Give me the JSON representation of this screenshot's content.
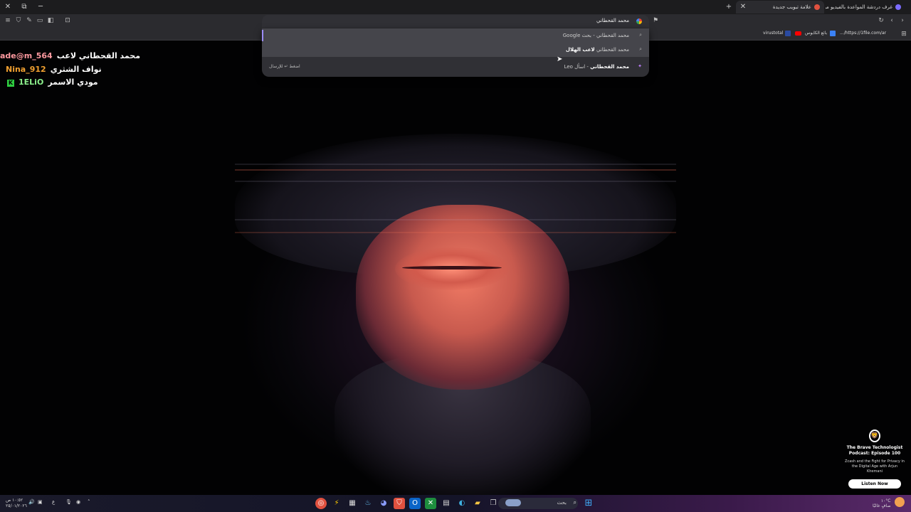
{
  "browser": {
    "tabs": [
      {
        "title": "علامة تبويب جديدة",
        "active": true
      },
      {
        "title": "غرف دردشة المواعدة بالفيديو من ..."
      }
    ],
    "window_buttons": {
      "close": "✕",
      "restore": "⧉",
      "minimize": "─"
    },
    "new_tab": "+",
    "tab_close": "✕"
  },
  "omnibox": {
    "value": "محمد القحطاني"
  },
  "suggestions": [
    {
      "bold": "محمد القحطاني",
      "rest": " - بحث Google"
    },
    {
      "bold": "لاعب الهلال",
      "rest": "محمد القحطاني "
    },
    {
      "bold": "محمد القحطاني",
      "rest": " - اسأل Leo"
    }
  ],
  "enter_hint": "اضغط ↵ للإرسال",
  "bookmarks": [
    {
      "label": "virustotal"
    },
    {
      "label": "بائع الكابوس"
    },
    {
      "label": "https://1file.com/ar/..."
    }
  ],
  "chat_overlay": [
    {
      "name": "ade@m_564",
      "message": "محمد القحطاني لاعب",
      "color": "#ff9aa0"
    },
    {
      "name": "Nina_912",
      "message": "نواف الشثري",
      "color": "#f0a030"
    },
    {
      "name": "1ELiO",
      "message": "مودي الاسمر",
      "color": "#8cf08c"
    }
  ],
  "podcast": {
    "logo": "🦁",
    "title": "The Brave Technologist Podcast: Episode 100",
    "description": "Zcash and the Fight for Privacy in the Digital Age with Arjun Khemani",
    "button": "Listen Now"
  },
  "taskbar": {
    "search_placeholder": "بحث",
    "time": "١٠:٥٢ ص",
    "date": "٢٥/٠١/٢٠٢٦",
    "lang": "ع",
    "weather_temp": "١٠°C",
    "weather_desc": "صافٍ غالبًا"
  },
  "colors": {
    "accent": "#9c8cff",
    "brave_orange": "#e0513f"
  }
}
